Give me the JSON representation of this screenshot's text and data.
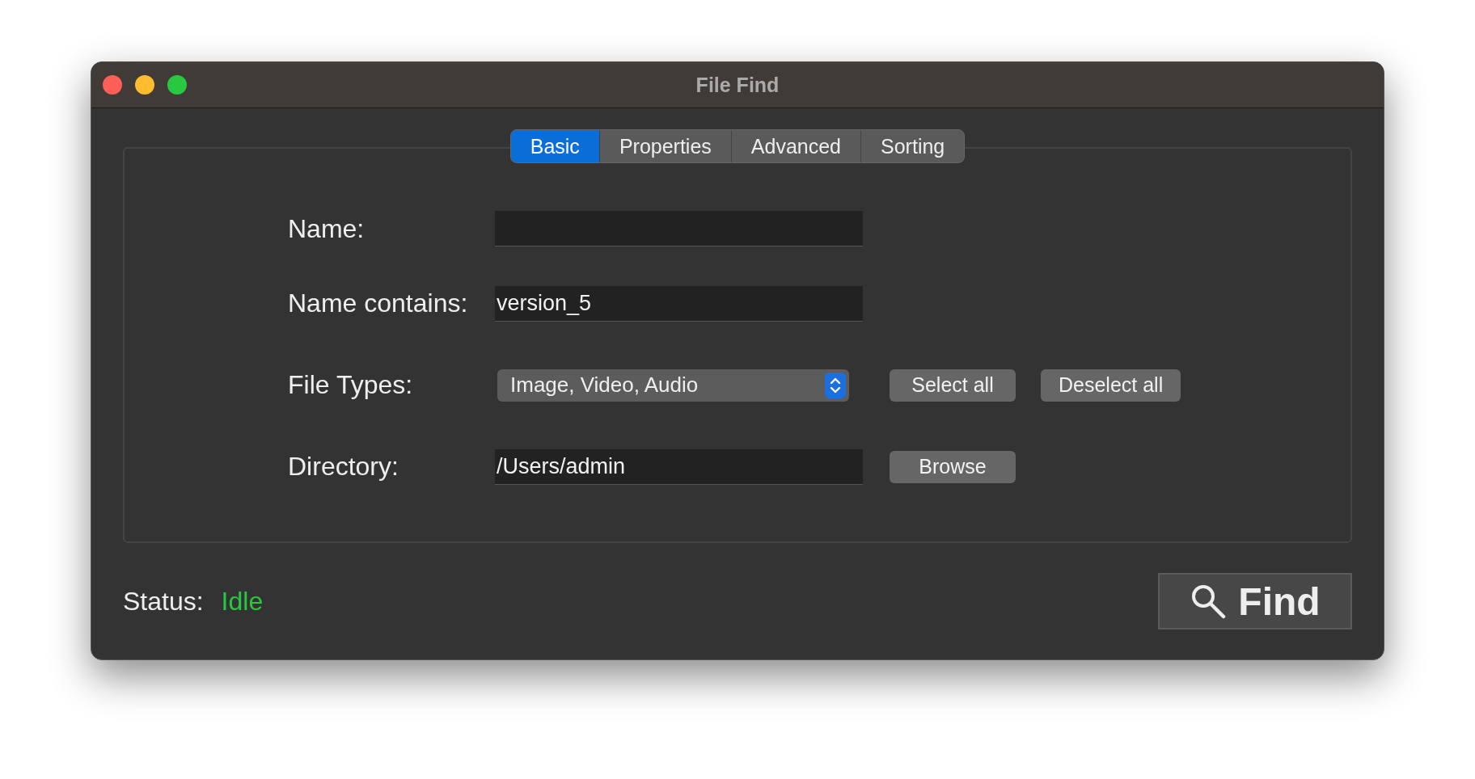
{
  "window": {
    "title": "File Find"
  },
  "tabs": [
    {
      "label": "Basic",
      "selected": true
    },
    {
      "label": "Properties",
      "selected": false
    },
    {
      "label": "Advanced",
      "selected": false
    },
    {
      "label": "Sorting",
      "selected": false
    }
  ],
  "form": {
    "name": {
      "label": "Name:"
    },
    "name_contains": {
      "label": "Name contains:",
      "value": "version_5"
    },
    "file_types": {
      "label": "File Types:",
      "value": "Image, Video, Audio",
      "buttons": [
        "Select all",
        "Deselect all"
      ]
    },
    "directory": {
      "label": "Directory:",
      "value": "/Users/admin",
      "button": "Browse"
    }
  },
  "status": {
    "label": "Status:",
    "value": "Idle",
    "color": "#28c840"
  },
  "find_button": {
    "label": "Find"
  }
}
